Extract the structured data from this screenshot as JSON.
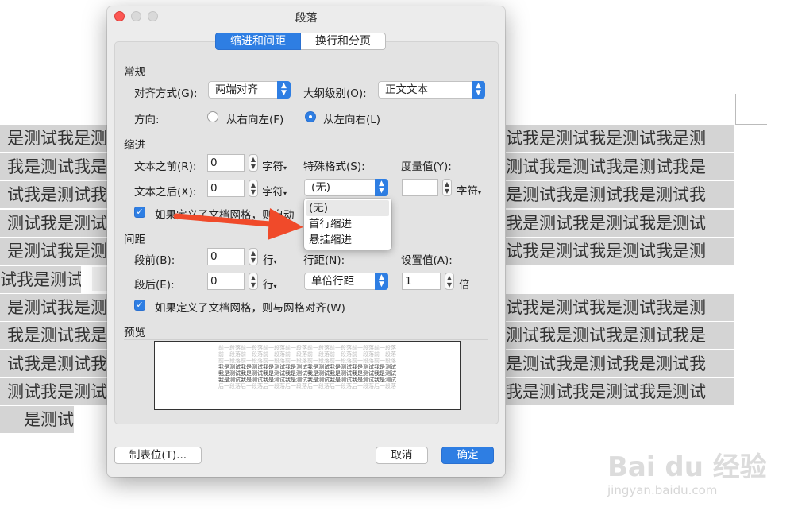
{
  "document": {
    "right_lines": [
      "试我是测试我是测试我是测",
      "测试我是测试我是测试我是",
      "是测试我是测试我是测试我",
      "我是测试我是测试我是测试",
      "试我是测试我是测试我是测",
      "试我是测试我是测试我是测",
      "测试我是测试我是测试我是",
      "是测试我是测试我是测试我",
      "我是测试我是测试我是测试"
    ],
    "left_lines": [
      "是测试我是测",
      "我是测试我是",
      "试我是测试我",
      "测试我是测试",
      "是测试我是测",
      "试我是测试",
      "是测试我是测",
      "我是测试我是",
      "试我是测试我",
      "测试我是测试",
      "是测试"
    ]
  },
  "dialog": {
    "title": "段落",
    "tabs": [
      {
        "label": "缩进和间距",
        "active": true
      },
      {
        "label": "换行和分页",
        "active": false
      }
    ],
    "general": {
      "section_label": "常规",
      "alignment_label": "对齐方式(G):",
      "alignment_value": "两端对齐",
      "outline_label": "大纲级别(O):",
      "outline_value": "正文文本",
      "direction_label": "方向:",
      "rtl_label": "从右向左(F)",
      "ltr_label": "从左向右(L)",
      "direction_selected": "ltr"
    },
    "indent": {
      "section_label": "缩进",
      "before_label": "文本之前(R):",
      "before_value": "0",
      "after_label": "文本之后(X):",
      "after_value": "0",
      "unit_chars": "字符",
      "special_label": "特殊格式(S):",
      "special_value": "(无)",
      "measure_label": "度量值(Y):",
      "measure_value": "",
      "grid_checkbox_label": "如果定义了文档网格，则自动",
      "grid_checked": true
    },
    "special_menu": {
      "options": [
        "(无)",
        "首行缩进",
        "悬挂缩进"
      ],
      "selected": "(无)"
    },
    "spacing": {
      "section_label": "间距",
      "before_label": "段前(B):",
      "before_value": "0",
      "after_label": "段后(E):",
      "after_value": "0",
      "unit_lines": "行",
      "line_spacing_label": "行距(N):",
      "line_spacing_value": "单倍行距",
      "setting_label": "设置值(A):",
      "setting_value": "1",
      "unit_times": "倍",
      "grid_checkbox_label": "如果定义了文档网格，则与网格对齐(W)",
      "grid_checked": true
    },
    "preview": {
      "section_label": "预览",
      "prev_paragraph": "前一段落前一段落前一段落前一段落前一段落前一段落前一段落前一段落",
      "sample": "我是测试我是测试我是测试我是测试我是测试我是测试我是测试我是测试",
      "next_paragraph": "后一段落后一段落后一段落后一段落后一段落后一段落后一段落后一段落"
    },
    "buttons": {
      "tabs_label": "制表位(T)...",
      "cancel_label": "取消",
      "ok_label": "确定"
    }
  },
  "watermark": {
    "logo_text": "Bai du 经验",
    "url": "jingyan.baidu.com"
  },
  "colors": {
    "accent": "#2e7ee3",
    "arrow": "#f04a2a",
    "selection_bg": "#d4d4d4",
    "dialog_bg": "#ececec"
  }
}
